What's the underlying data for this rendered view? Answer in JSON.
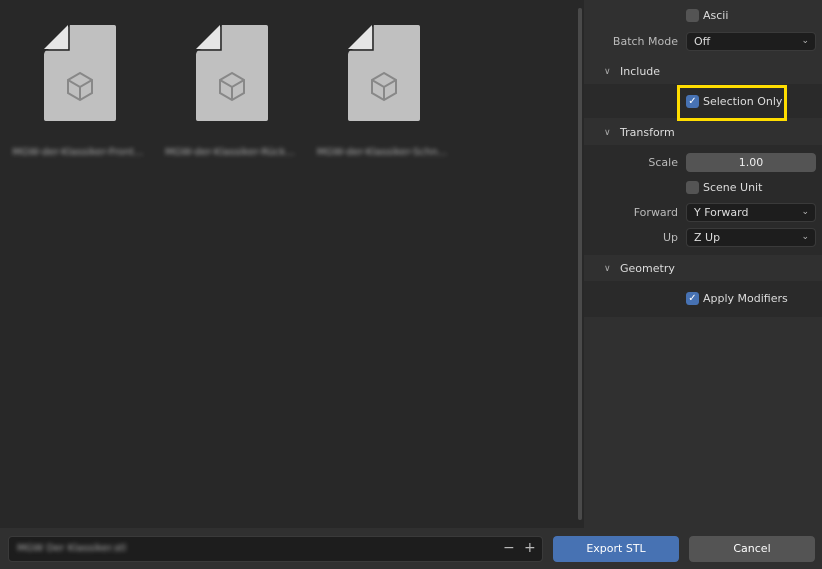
{
  "files": [
    {
      "name": "MGW-der-Klassiker-Front..."
    },
    {
      "name": "MGW-der-Klassiker-Rück..."
    },
    {
      "name": "MGW-der-Klassiker-Schn..."
    }
  ],
  "panel": {
    "ascii": {
      "label": "Ascii",
      "checked": false
    },
    "batch_mode": {
      "label": "Batch Mode",
      "value": "Off"
    },
    "include": {
      "title": "Include",
      "selection_only": {
        "label": "Selection Only",
        "checked": true
      }
    },
    "transform": {
      "title": "Transform",
      "scale": {
        "label": "Scale",
        "value": "1.00"
      },
      "scene_unit": {
        "label": "Scene Unit",
        "checked": false
      },
      "forward": {
        "label": "Forward",
        "value": "Y Forward"
      },
      "up": {
        "label": "Up",
        "value": "Z Up"
      }
    },
    "geometry": {
      "title": "Geometry",
      "apply_modifiers": {
        "label": "Apply Modifiers",
        "checked": true
      }
    }
  },
  "bottom": {
    "filename": "MGW Der Klassiker.stl",
    "minus": "−",
    "plus": "+",
    "export_label": "Export STL",
    "cancel_label": "Cancel"
  },
  "colors": {
    "accent": "#4772b3",
    "highlight": "#ffdd00"
  }
}
